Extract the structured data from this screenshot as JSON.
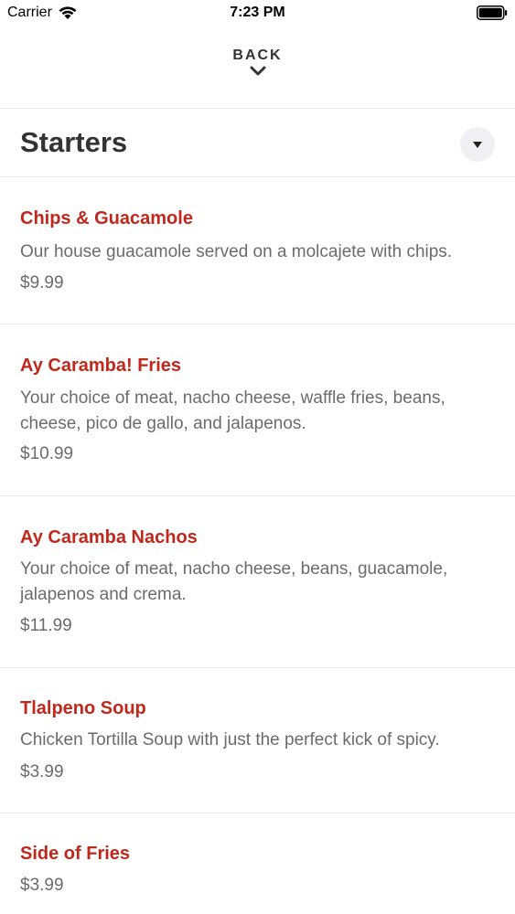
{
  "status_bar": {
    "carrier": "Carrier",
    "time": "7:23 PM"
  },
  "nav": {
    "back_label": "BACK"
  },
  "section": {
    "title": "Starters"
  },
  "colors": {
    "item_name": "#c0281c",
    "text_muted": "#6b6b6b"
  },
  "items": [
    {
      "name": "Chips & Guacamole",
      "description": "Our house guacamole served on a molcajete with chips.",
      "price": "$9.99"
    },
    {
      "name": "Ay Caramba! Fries",
      "description": "Your choice of meat, nacho cheese, waffle fries, beans, cheese, pico de gallo, and jalapenos.",
      "price": "$10.99"
    },
    {
      "name": "Ay Caramba Nachos",
      "description": "Your choice of meat, nacho cheese, beans, guacamole, jalapenos and crema.",
      "price": "$11.99"
    },
    {
      "name": "Tlalpeno Soup",
      "description": "Chicken Tortilla Soup with just the perfect kick of spicy.",
      "price": "$3.99"
    },
    {
      "name": "Side of Fries",
      "description": "",
      "price": "$3.99"
    }
  ]
}
